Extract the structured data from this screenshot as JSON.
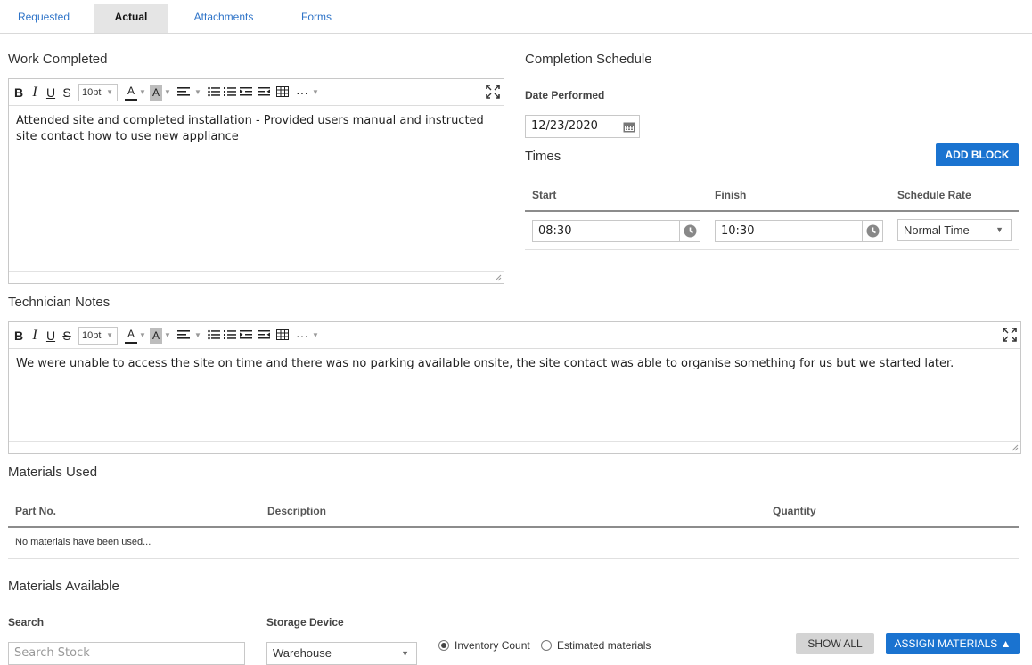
{
  "tabs": [
    {
      "label": "Requested"
    },
    {
      "label": "Actual"
    },
    {
      "label": "Attachments"
    },
    {
      "label": "Forms"
    }
  ],
  "work_completed": {
    "heading": "Work Completed",
    "font_size": "10pt",
    "content": "Attended site and completed installation - Provided users manual and instructed site contact how to use new appliance"
  },
  "technician_notes": {
    "heading": "Technician Notes",
    "font_size": "10pt",
    "content": "We were unable to access the site on time and there was no parking available onsite, the site contact was able to organise something for us but we started later."
  },
  "completion_schedule": {
    "heading": "Completion Schedule",
    "date_label": "Date Performed",
    "date_value": "12/23/2020",
    "times_heading": "Times",
    "add_block_label": "ADD BLOCK",
    "columns": {
      "start": "Start",
      "finish": "Finish",
      "rate": "Schedule Rate"
    },
    "row": {
      "start": "08:30",
      "finish": "10:30",
      "rate": "Normal Time"
    }
  },
  "materials_used": {
    "heading": "Materials Used",
    "columns": {
      "part": "Part No.",
      "description": "Description",
      "quantity": "Quantity"
    },
    "empty_text": "No materials have been used..."
  },
  "materials_available": {
    "heading": "Materials Available",
    "search_label": "Search",
    "search_placeholder": "Search Stock",
    "storage_label": "Storage Device",
    "storage_value": "Warehouse",
    "radio_inventory": "Inventory Count",
    "radio_estimated": "Estimated materials",
    "show_all_label": "SHOW ALL",
    "assign_label": "ASSIGN MATERIALS ▲"
  },
  "colors": {
    "accent": "#1a73d0",
    "tab_active_bg": "#e5e5e5",
    "link": "#2f74c8"
  },
  "icons": [
    "bold-icon",
    "italic-icon",
    "underline-icon",
    "strikethrough-icon",
    "font-color-icon",
    "highlight-icon",
    "align-icon",
    "bullet-list-icon",
    "numbered-list-icon",
    "indent-icon",
    "outdent-icon",
    "table-icon",
    "more-icon",
    "fullscreen-icon",
    "calendar-icon",
    "clock-icon"
  ]
}
